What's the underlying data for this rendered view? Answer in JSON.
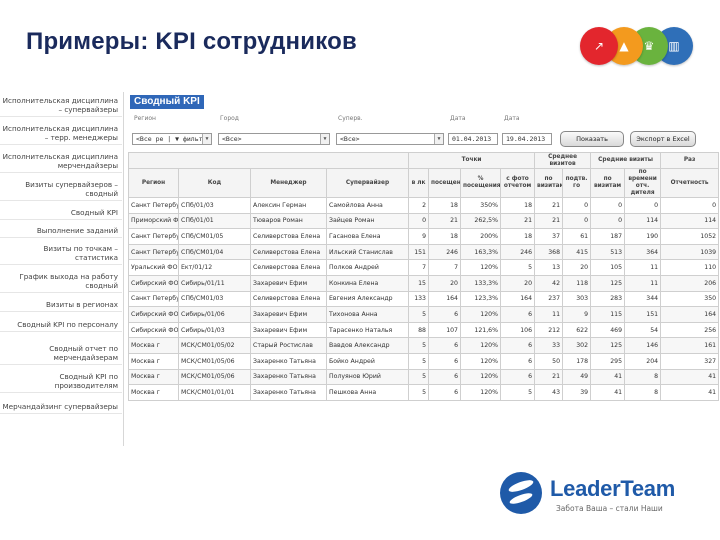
{
  "slide": {
    "title": "Примеры: KPI сотрудников",
    "badges": [
      {
        "icon": "chart-up-icon",
        "glyph": "↗",
        "color": "#e3262d"
      },
      {
        "icon": "people-icon",
        "glyph": "▲",
        "color": "#f39a1e"
      },
      {
        "icon": "trophy-icon",
        "glyph": "♛",
        "color": "#6ab33e"
      },
      {
        "icon": "book-icon",
        "glyph": "▥",
        "color": "#2f6fb8"
      }
    ]
  },
  "menu": {
    "items": [
      {
        "label": "Исполнительская дисциплина – супервайзеры"
      },
      {
        "label": "Исполнительская дисциплина – терр. менеджеры"
      },
      {
        "label": "Исполнительская дисциплина мерчендайзеры"
      },
      {
        "label": "Визиты супервайзеров – сводный"
      },
      {
        "label": "Сводный KPI"
      },
      {
        "label": "Выполнение заданий"
      },
      {
        "label": "Визиты по точкам – статистика"
      },
      {
        "label": "График выхода на работу сводный"
      },
      {
        "label": "Визиты в регионах"
      },
      {
        "label": "Сводный KPI по персоналу"
      },
      {
        "label": "Сводный отчет по мерчендайзерам"
      },
      {
        "label": "Сводный KPI по производителям"
      },
      {
        "label": "Мерчандайзинг супервайзеры"
      }
    ]
  },
  "panel": {
    "title": "Сводный KPI",
    "filters": {
      "labels": [
        "Регион",
        "Город",
        "Суперв.",
        "Дата",
        "Дата"
      ],
      "values": [
        "<Все ре | ▼ фильтр",
        "<Все>",
        "<Все>",
        "01.04.2013",
        "19.04.2013"
      ],
      "buttons": [
        "Показать",
        "Экспорт в Excel"
      ]
    }
  },
  "table": {
    "group_headers": [
      "Точки",
      "Среднее визитов",
      "Средние визиты",
      "Раз"
    ],
    "headers": [
      "Регион",
      "Код",
      "Менеджер",
      "Супервайзер",
      "в лк",
      "посещено",
      "% посещения",
      "с фото отчетом",
      "по визитам",
      "подтв. го",
      "по визитам",
      "по времени отч. дителя",
      "Отчетность"
    ],
    "rows": [
      [
        "Санкт Петербург г",
        "СПб/01/03",
        "Алексин Герман",
        "Самойлова Анна",
        "2",
        "18",
        "350%",
        "18",
        "21",
        "0",
        "0",
        "0",
        "0"
      ],
      [
        "Приморский ФО",
        "СПб/01/01",
        "Тюваров Роман",
        "Зайцев Роман",
        "0",
        "21",
        "262,5%",
        "21",
        "21",
        "0",
        "0",
        "114",
        "114"
      ],
      [
        "Санкт Петербург г",
        "СПб/СМ01/05",
        "Селиверстова Елена",
        "Гасанова Елена",
        "9",
        "18",
        "200%",
        "18",
        "37",
        "61",
        "187",
        "190",
        "1052"
      ],
      [
        "Санкт Петербург г",
        "СПб/СМ01/04",
        "Селиверстова Елена",
        "Ильский Станислав",
        "151",
        "246",
        "163,3%",
        "246",
        "368",
        "415",
        "513",
        "364",
        "1039"
      ],
      [
        "Уральский ФО",
        "Ект/01/12",
        "Селиверстова Елена",
        "Полков Андрей",
        "7",
        "7",
        "120%",
        "5",
        "13",
        "20",
        "105",
        "11",
        "110"
      ],
      [
        "Сибирский ФО",
        "Сибирь/01/11",
        "Захаревич Ефим",
        "Конкина Елена",
        "15",
        "20",
        "133,3%",
        "20",
        "42",
        "118",
        "125",
        "11",
        "206"
      ],
      [
        "Санкт Петербург г",
        "СПб/СМ01/03",
        "Селиверстова Елена",
        "Евгения Александр",
        "133",
        "164",
        "123,3%",
        "164",
        "237",
        "303",
        "283",
        "344",
        "350"
      ],
      [
        "Сибирский ФО",
        "Сибирь/01/06",
        "Захаревич Ефим",
        "Тихонова Анна",
        "5",
        "6",
        "120%",
        "6",
        "11",
        "9",
        "115",
        "151",
        "164"
      ],
      [
        "Сибирский ФО",
        "Сибирь/01/03",
        "Захаревич Ефим",
        "Тарасенко Наталья",
        "88",
        "107",
        "121,6%",
        "106",
        "212",
        "622",
        "469",
        "54",
        "256"
      ],
      [
        "Москва г",
        "МСК/СМ01/05/02",
        "Старый Ростислав",
        "Вавдов Александр",
        "5",
        "6",
        "120%",
        "6",
        "33",
        "302",
        "125",
        "146",
        "161"
      ],
      [
        "Москва г",
        "МСК/СМ01/05/06",
        "Захаренко Татьяна",
        "Бойко Андрей",
        "5",
        "6",
        "120%",
        "6",
        "50",
        "178",
        "295",
        "204",
        "327"
      ],
      [
        "Москва г",
        "МСК/СМ01/05/06",
        "Захаренко Татьяна",
        "Полуянов Юрий",
        "5",
        "6",
        "120%",
        "6",
        "21",
        "49",
        "41",
        "8",
        "41"
      ],
      [
        "Москва г",
        "МСК/СМ01/01/01",
        "Захаренко Татьяна",
        "Пешкова Анна",
        "5",
        "6",
        "120%",
        "5",
        "43",
        "39",
        "41",
        "8",
        "41"
      ]
    ]
  },
  "logo": {
    "name": "LeaderTeam",
    "tagline": "Забота Ваша – стали Наши",
    "color": "#1f5aa8"
  }
}
